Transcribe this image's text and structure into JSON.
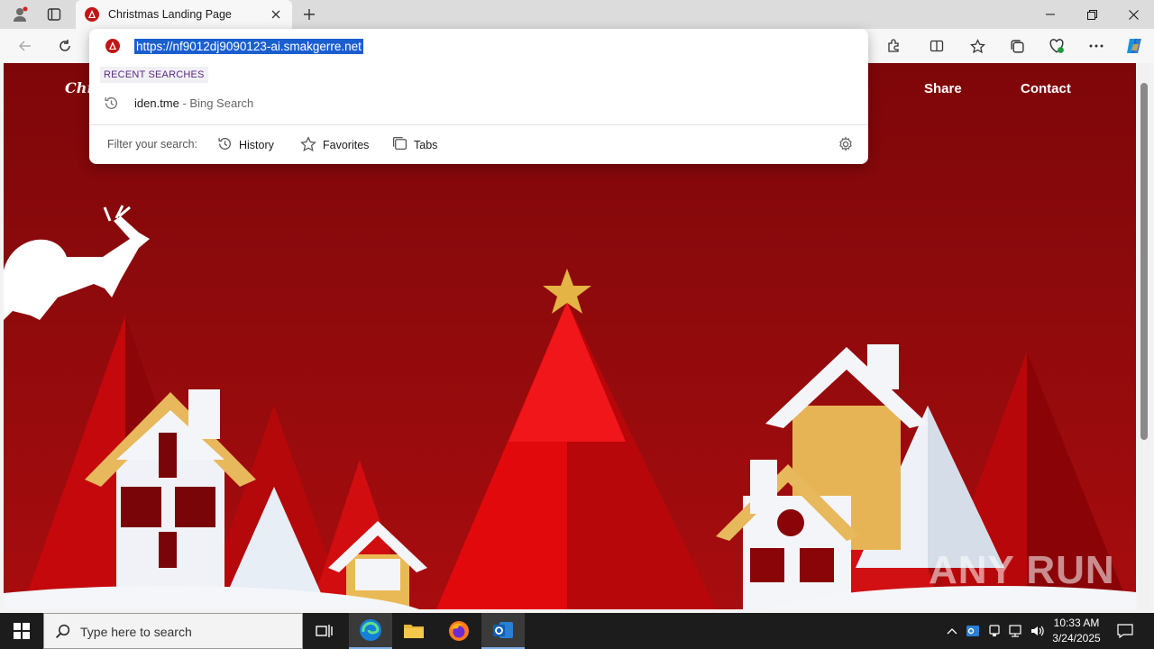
{
  "browser": {
    "tab_title": "Christmas Landing Page",
    "url": "https://nf9012dj9090123-ai.smakgerre.net"
  },
  "omnibox": {
    "recent_label": "RECENT SEARCHES",
    "recent_query": "iden.tme",
    "recent_suffix": " - Bing Search",
    "filter_label": "Filter your search:",
    "filters": [
      "History",
      "Favorites",
      "Tabs"
    ]
  },
  "page": {
    "logo": "Chri",
    "nav": [
      "Share",
      "Contact"
    ]
  },
  "taskbar": {
    "search_placeholder": "Type here to search",
    "time": "10:33 AM",
    "date": "3/24/2025"
  },
  "watermark": "ANY RUN",
  "colors": {
    "page_red": "#8d0a0c",
    "highlight": "#1a5fd0",
    "recent_label": "#5b2a86"
  }
}
